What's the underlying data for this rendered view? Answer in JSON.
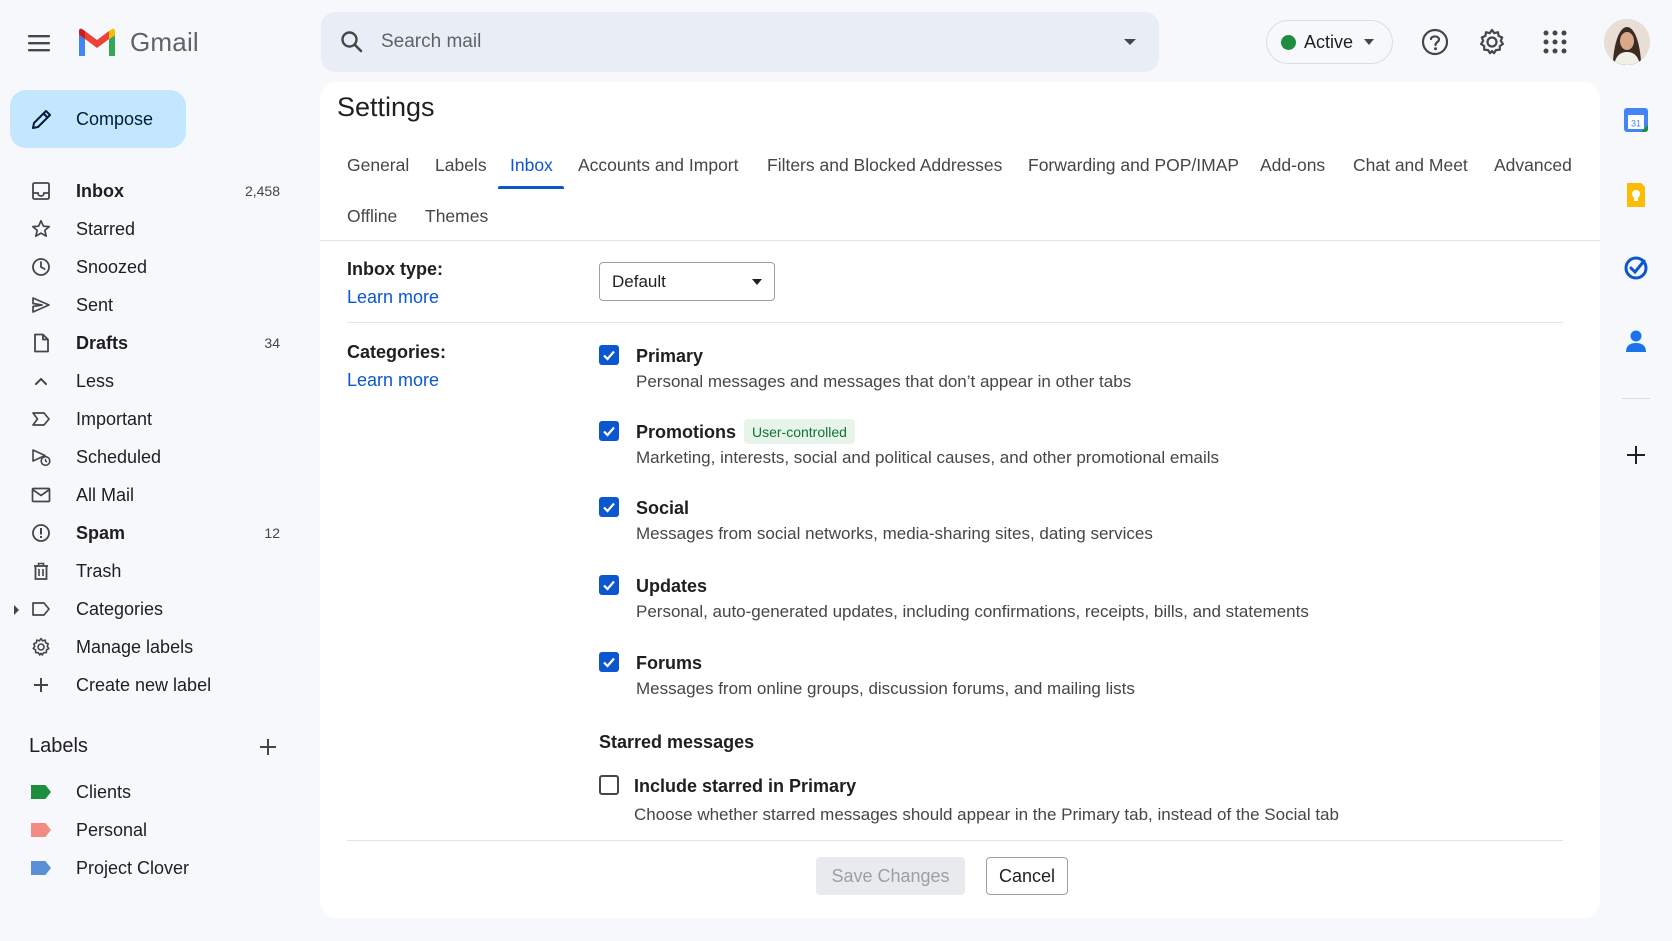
{
  "app": {
    "name": "Gmail"
  },
  "search": {
    "placeholder": "Search mail"
  },
  "status": {
    "label": "Active",
    "color": "#1e8e3e"
  },
  "header_icons": [
    "main-menu-icon",
    "help-icon",
    "gear-icon",
    "apps-grid-icon",
    "avatar"
  ],
  "compose": {
    "label": "Compose"
  },
  "nav": {
    "items": [
      {
        "label": "Inbox",
        "count": "2,458",
        "bold": true,
        "icon": "inbox-icon"
      },
      {
        "label": "Starred",
        "count": "",
        "bold": false,
        "icon": "star-icon"
      },
      {
        "label": "Snoozed",
        "count": "",
        "bold": false,
        "icon": "clock-icon"
      },
      {
        "label": "Sent",
        "count": "",
        "bold": false,
        "icon": "send-icon"
      },
      {
        "label": "Drafts",
        "count": "34",
        "bold": true,
        "icon": "draft-icon"
      },
      {
        "label": "Less",
        "count": "",
        "bold": false,
        "icon": "chevron-up-icon"
      },
      {
        "label": "Important",
        "count": "",
        "bold": false,
        "icon": "important-icon"
      },
      {
        "label": "Scheduled",
        "count": "",
        "bold": false,
        "icon": "scheduled-icon"
      },
      {
        "label": "All Mail",
        "count": "",
        "bold": false,
        "icon": "all-mail-icon"
      },
      {
        "label": "Spam",
        "count": "12",
        "bold": true,
        "icon": "spam-icon"
      },
      {
        "label": "Trash",
        "count": "",
        "bold": false,
        "icon": "trash-icon"
      },
      {
        "label": "Categories",
        "count": "",
        "bold": false,
        "icon": "label-outline-icon"
      },
      {
        "label": "Manage labels",
        "count": "",
        "bold": false,
        "icon": "gear-icon"
      },
      {
        "label": "Create new label",
        "count": "",
        "bold": false,
        "icon": "plus-icon"
      }
    ]
  },
  "labels": {
    "title": "Labels",
    "items": [
      {
        "label": "Clients",
        "color": "#1e8e3e"
      },
      {
        "label": "Personal",
        "color": "#f28b82"
      },
      {
        "label": "Project Clover",
        "color": "#5b8fd6"
      }
    ]
  },
  "settings": {
    "title": "Settings",
    "tabs": [
      {
        "label": "General",
        "active": false
      },
      {
        "label": "Labels",
        "active": false
      },
      {
        "label": "Inbox",
        "active": true
      },
      {
        "label": "Accounts and Import",
        "active": false
      },
      {
        "label": "Filters and Blocked Addresses",
        "active": false
      },
      {
        "label": "Forwarding and POP/IMAP",
        "active": false
      },
      {
        "label": "Add-ons",
        "active": false
      },
      {
        "label": "Chat and Meet",
        "active": false
      },
      {
        "label": "Advanced",
        "active": false
      },
      {
        "label": "Offline",
        "active": false
      },
      {
        "label": "Themes",
        "active": false
      }
    ],
    "inbox_type": {
      "label": "Inbox type:",
      "learn_more": "Learn more",
      "value": "Default"
    },
    "categories": {
      "label": "Categories:",
      "learn_more": "Learn more",
      "items": [
        {
          "title": "Primary",
          "desc": "Personal messages and messages that don’t appear in other tabs",
          "checked": true,
          "badge": ""
        },
        {
          "title": "Promotions",
          "desc": "Marketing, interests, social and political causes, and other promotional emails",
          "checked": true,
          "badge": "User-controlled"
        },
        {
          "title": "Social",
          "desc": "Messages from social networks, media-sharing sites, dating services",
          "checked": true,
          "badge": ""
        },
        {
          "title": "Updates",
          "desc": "Personal, auto-generated updates, including confirmations, receipts, bills, and statements",
          "checked": true,
          "badge": ""
        },
        {
          "title": "Forums",
          "desc": "Messages from online groups, discussion forums, and mailing lists",
          "checked": true,
          "badge": ""
        }
      ]
    },
    "starred": {
      "heading": "Starred messages",
      "option": "Include starred in Primary",
      "desc": "Choose whether starred messages should appear in the Primary tab, instead of the Social tab",
      "checked": false
    },
    "buttons": {
      "save": "Save Changes",
      "cancel": "Cancel"
    }
  },
  "side_panel": [
    "calendar-icon",
    "keep-icon",
    "tasks-icon",
    "contacts-icon",
    "add-addon-icon"
  ],
  "colors": {
    "accent": "#0b57d0",
    "compose_bg": "#c2e7ff",
    "page_bg": "#f6f8fc"
  }
}
